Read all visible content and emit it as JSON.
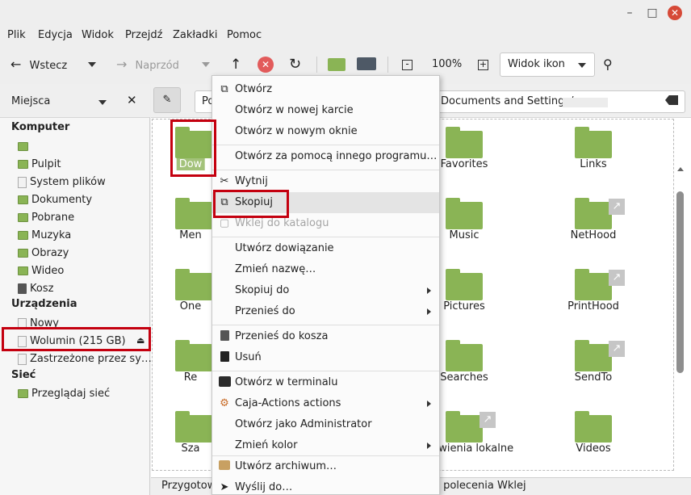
{
  "menubar": [
    "Plik",
    "Edycja",
    "Widok",
    "Przejdź",
    "Zakładki",
    "Pomoc"
  ],
  "toolbar": {
    "back": "Wstecz",
    "forward": "Naprzód",
    "zoom": "100%",
    "view_mode": "Widok ikon"
  },
  "sidebar": {
    "header": "Miejsca",
    "sections": [
      {
        "title": "Komputer",
        "items": [
          "",
          "Pulpit",
          "System plików",
          "Dokumenty",
          "Pobrane",
          "Muzyka",
          "Obrazy",
          "Wideo",
          "Kosz"
        ]
      },
      {
        "title": "Urządzenia",
        "items": [
          "Nowy",
          "Wolumin (215 GB)",
          "Zastrzeżone przez sy…"
        ]
      },
      {
        "title": "Sieć",
        "items": [
          "Przeglądaj sieć"
        ]
      }
    ]
  },
  "location": {
    "prefix": "Po",
    "path": "Documents and Settings/"
  },
  "files": [
    {
      "label": "Dow",
      "link": false
    },
    {
      "label": "Favorites",
      "link": false
    },
    {
      "label": "Links",
      "link": false
    },
    {
      "label": "Men",
      "link": false
    },
    {
      "label": "Music",
      "link": false
    },
    {
      "label": "NetHood",
      "link": true
    },
    {
      "label": "One",
      "link": false
    },
    {
      "label": "Pictures",
      "link": false
    },
    {
      "label": "PrintHood",
      "link": true
    },
    {
      "label": "Re",
      "link": false
    },
    {
      "label": "Searches",
      "link": false
    },
    {
      "label": "SendTo",
      "link": true
    },
    {
      "label": "Sza",
      "link": false
    },
    {
      "label": "Ustawienia lokalne",
      "link": true
    },
    {
      "label": "Videos",
      "link": false
    }
  ],
  "status": {
    "left": "Przygotow",
    "right": "a polecenia Wklej"
  },
  "context_menu": {
    "open": "Otwórz",
    "open_tab": "Otwórz w nowej karcie",
    "open_window": "Otwórz w nowym oknie",
    "open_with": "Otwórz za pomocą innego programu…",
    "cut": "Wytnij",
    "copy": "Skopiuj",
    "paste_into": "Wklej do katalogu",
    "make_link": "Utwórz dowiązanie",
    "rename": "Zmień nazwę…",
    "copy_to": "Skopiuj do",
    "move_to": "Przenieś do",
    "trash": "Przenieś do kosza",
    "delete": "Usuń",
    "terminal": "Otwórz w terminalu",
    "caja_actions": "Caja-Actions actions",
    "admin": "Otwórz jako Administrator",
    "color": "Zmień kolor",
    "archive": "Utwórz archiwum…",
    "send": "Wyślij do…"
  }
}
